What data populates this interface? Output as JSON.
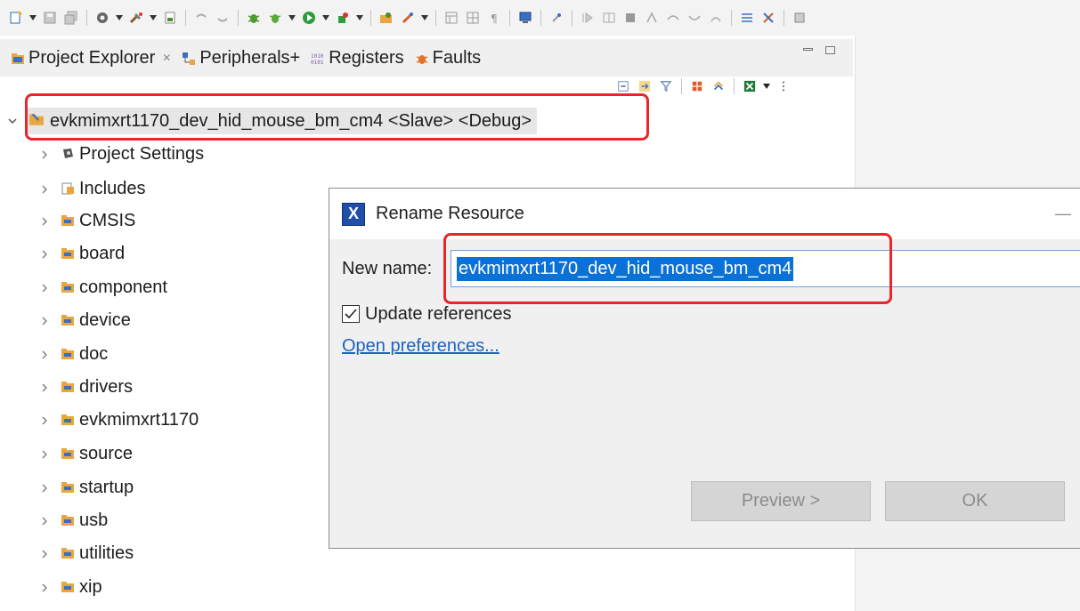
{
  "toolbar": {
    "icons": [
      "new-icon",
      "save-icon",
      "save-all-icon",
      "settings-icon",
      "build-icon",
      "clipboard-icon",
      "undo-icon",
      "redo-icon",
      "debug-icon",
      "debug-alt-icon",
      "run-icon",
      "external-tools-icon",
      "open-perspective-icon",
      "rocket-icon",
      "layout-icon",
      "table-icon",
      "pilcrow-icon",
      "monitor-icon",
      "pin-icon",
      "step-icon",
      "memory-icon",
      "stop-icon",
      "terminate-icon",
      "step-over-icon",
      "step-return-icon",
      "resume-icon",
      "list-icon",
      "link-icon",
      "cpu-icon"
    ]
  },
  "view_tabs": [
    {
      "label": "Project Explorer",
      "icon": "project-explorer-icon",
      "close": "✕"
    },
    {
      "label": "Peripherals+",
      "icon": "peripherals-icon"
    },
    {
      "label": "Registers",
      "icon": "registers-icon"
    },
    {
      "label": "Faults",
      "icon": "faults-icon"
    }
  ],
  "view_toolbar": {
    "icons": [
      "collapse-all-icon",
      "link-editor-icon",
      "filter-icon",
      "grid-icon",
      "sync-icon",
      "excel-icon",
      "view-menu-icon"
    ]
  },
  "tree": {
    "root": {
      "label": "evkmimxrt1170_dev_hid_mouse_bm_cm4 <Slave> <Debug>",
      "icon": "project-icon",
      "expanded": true
    },
    "items": [
      {
        "label": "Project Settings",
        "icon": "settings-icon"
      },
      {
        "label": "Includes",
        "icon": "includes-icon"
      },
      {
        "label": "CMSIS",
        "icon": "folder-icon"
      },
      {
        "label": "board",
        "icon": "folder-icon"
      },
      {
        "label": "component",
        "icon": "folder-icon"
      },
      {
        "label": "device",
        "icon": "folder-icon"
      },
      {
        "label": "doc",
        "icon": "folder-icon"
      },
      {
        "label": "drivers",
        "icon": "folder-icon"
      },
      {
        "label": "evkmimxrt1170",
        "icon": "folder-icon"
      },
      {
        "label": "source",
        "icon": "folder-icon"
      },
      {
        "label": "startup",
        "icon": "folder-icon"
      },
      {
        "label": "usb",
        "icon": "folder-icon"
      },
      {
        "label": "utilities",
        "icon": "folder-icon"
      },
      {
        "label": "xip",
        "icon": "folder-icon"
      }
    ]
  },
  "dialog": {
    "title": "Rename Resource",
    "app_icon_letter": "X",
    "minimize": "—",
    "new_name_label": "New name:",
    "new_name_value": "evkmimxrt1170_dev_hid_mouse_bm_cm4",
    "update_references_label": "Update references",
    "update_references_checked": true,
    "open_preferences_link": "Open preferences...",
    "preview_button": "Preview >",
    "ok_button": "OK"
  },
  "colors": {
    "highlight_box": "#e8252a",
    "selection": "#0a72d6",
    "link": "#1a63c9",
    "folder": "#e9a640"
  }
}
